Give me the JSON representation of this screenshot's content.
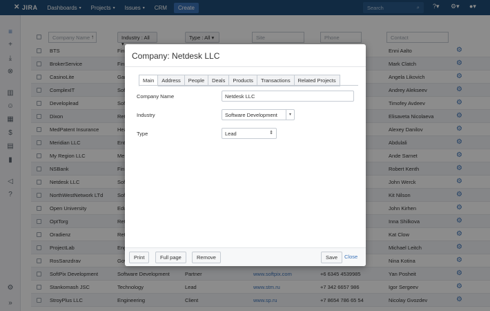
{
  "topnav": {
    "logo": "JIRA",
    "items": [
      "Dashboards",
      "Projects",
      "Issues",
      "CRM"
    ],
    "create": "Create",
    "search_placeholder": "Search"
  },
  "table": {
    "headers": {
      "name_placeholder": "Company Name",
      "industry": "Industry : All",
      "type": "Type : All",
      "site": "Site",
      "phone": "Phone",
      "contact": "Contact"
    },
    "rows": [
      {
        "name": "BTS",
        "industry": "Fin",
        "type": "",
        "site": "",
        "phone": "",
        "contact": "Enni Aalto"
      },
      {
        "name": "BrokerService",
        "industry": "Fin",
        "type": "",
        "site": "",
        "phone": "",
        "contact": "Mark Clatch"
      },
      {
        "name": "CasinoLite",
        "industry": "Gar",
        "type": "",
        "site": "",
        "phone": "",
        "contact": "Angela Likovich"
      },
      {
        "name": "ComplexIT",
        "industry": "Sof",
        "type": "",
        "site": "",
        "phone": "",
        "contact": "Andrey Alekseev"
      },
      {
        "name": "Developlead",
        "industry": "Sof",
        "type": "",
        "site": "",
        "phone": "",
        "contact": "Timofey Avdeev"
      },
      {
        "name": "Dixon",
        "industry": "Ret",
        "type": "",
        "site": "",
        "phone": "",
        "contact": "Elisaveta Nicolaeva"
      },
      {
        "name": "MedPatent Insurance",
        "industry": "Hea",
        "type": "",
        "site": "",
        "phone": "",
        "contact": "Alexey Danilov"
      },
      {
        "name": "Meridian LLC",
        "industry": "Ent",
        "type": "",
        "site": "",
        "phone": "",
        "contact": "Abdulali"
      },
      {
        "name": "My Region LLC",
        "industry": "Me",
        "type": "",
        "site": "",
        "phone": "",
        "contact": "Ande Sarnet"
      },
      {
        "name": "NSBank",
        "industry": "Fin",
        "type": "",
        "site": "",
        "phone": "",
        "contact": "Robert Kenth"
      },
      {
        "name": "Netdesk LLC",
        "industry": "Sof",
        "type": "",
        "site": "",
        "phone": "",
        "contact": "John Werck"
      },
      {
        "name": "NorthWestNetwork LTd",
        "industry": "Sof",
        "type": "",
        "site": "",
        "phone": "",
        "contact": "Kit Nilson"
      },
      {
        "name": "Open University",
        "industry": "Edu",
        "type": "",
        "site": "",
        "phone": "",
        "contact": "John Kirhen"
      },
      {
        "name": "OptTorg",
        "industry": "Ret",
        "type": "",
        "site": "",
        "phone": "",
        "contact": "Inna Shilkova"
      },
      {
        "name": "Oradienz",
        "industry": "Ret",
        "type": "",
        "site": "",
        "phone": "",
        "contact": "Kat Clow"
      },
      {
        "name": "ProjectLab",
        "industry": "Eng",
        "type": "",
        "site": "",
        "phone": "",
        "contact": "Michael Leitch"
      },
      {
        "name": "RosSanzdrav",
        "industry": "Gov",
        "type": "",
        "site": "",
        "phone": "",
        "contact": "Nina Kotina"
      },
      {
        "name": "SoftPix Development",
        "industry": "Software Development",
        "type": "Partner",
        "site": "www.softpix.com",
        "phone": "+6 6345 4539985",
        "contact": "Yan Posheit"
      },
      {
        "name": "Stankomash JSC",
        "industry": "Technology",
        "type": "Lead",
        "site": "www.stm.ru",
        "phone": "+7 342 6657 986",
        "contact": "Igor Sergeev"
      },
      {
        "name": "StroyPlus LLC",
        "industry": "Engineering",
        "type": "Client",
        "site": "www.sp.ru",
        "phone": "+7 8654 786 65 54",
        "contact": "Nicolay Gvozdev"
      }
    ]
  },
  "modal": {
    "title": "Company: Netdesk LLC",
    "tabs": [
      "Main",
      "Address",
      "People",
      "Deals",
      "Products",
      "Transactions",
      "Related Projects"
    ],
    "fields": {
      "company_name_label": "Company Name",
      "company_name_value": "Netdesk LLC",
      "industry_label": "Industry",
      "industry_value": "Software Development",
      "type_label": "Type",
      "type_value": "Lead"
    },
    "footer": {
      "print": "Print",
      "full_page": "Full page",
      "remove": "Remove",
      "save": "Save",
      "close": "Close"
    }
  }
}
